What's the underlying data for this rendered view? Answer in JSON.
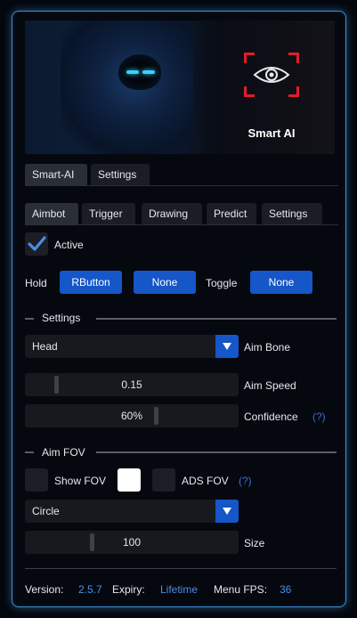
{
  "banner": {
    "logo_text": "Smart AI"
  },
  "main_tabs": [
    {
      "label": "Smart-AI",
      "active": true
    },
    {
      "label": "Settings",
      "active": false
    }
  ],
  "sub_tabs": [
    {
      "label": "Aimbot",
      "active": true
    },
    {
      "label": "Trigger",
      "active": false
    },
    {
      "label": "Drawing",
      "active": false
    },
    {
      "label": "Predict",
      "active": false
    },
    {
      "label": "Settings",
      "active": false
    }
  ],
  "active": {
    "label": "Active",
    "checked": true
  },
  "hold": {
    "label": "Hold",
    "key1": "RButton",
    "key2": "None"
  },
  "toggle": {
    "label": "Toggle",
    "key": "None"
  },
  "settings_section": {
    "title": "Settings"
  },
  "aim_bone": {
    "value": "Head",
    "label": "Aim Bone"
  },
  "aim_speed": {
    "value": "0.15",
    "label": "Aim Speed"
  },
  "confidence": {
    "value": "60%",
    "label": "Confidence",
    "help": "(?)"
  },
  "fov_section": {
    "title": "Aim FOV"
  },
  "show_fov": {
    "label": "Show FOV",
    "checked": false,
    "color": "#ffffff"
  },
  "ads_fov": {
    "label": "ADS FOV",
    "checked": false,
    "help": "(?)"
  },
  "fov_shape": {
    "value": "Circle"
  },
  "size": {
    "value": "100",
    "label": "Size"
  },
  "footer": {
    "version_label": "Version:",
    "version": "2.5.7",
    "expiry_label": "Expiry:",
    "expiry": "Lifetime",
    "fps_label": "Menu FPS:",
    "fps": "36"
  },
  "colors": {
    "accent": "#1556c8",
    "border": "#3a8fd6",
    "link": "#4b8de6",
    "logo_red": "#e21b2c"
  }
}
